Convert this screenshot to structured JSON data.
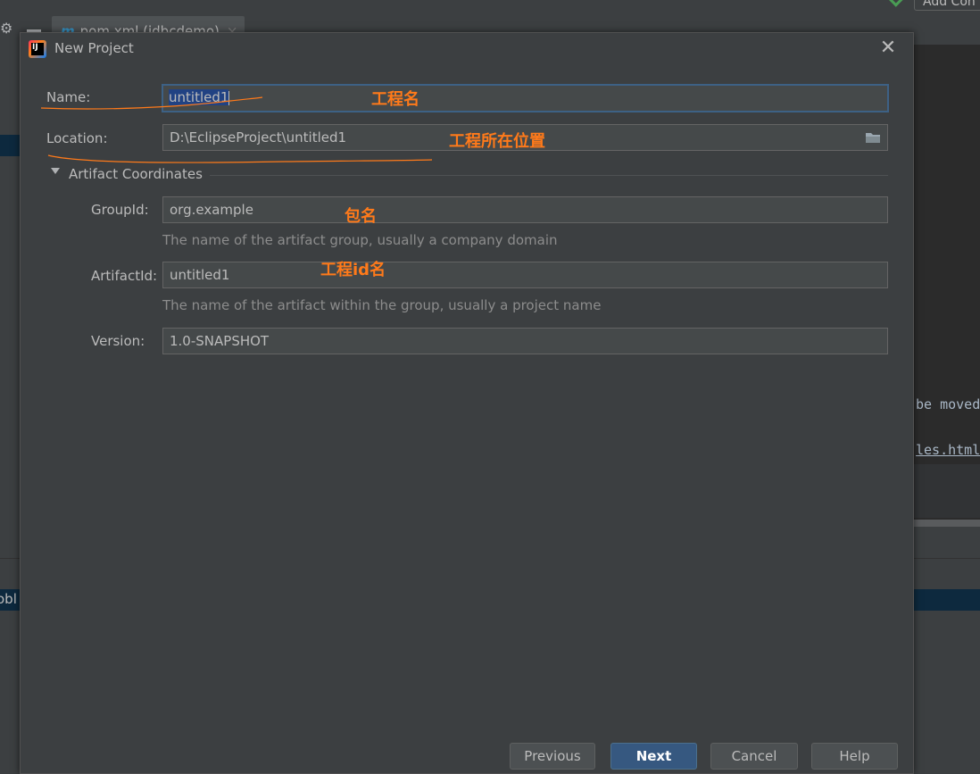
{
  "ide": {
    "tab_label": "pom.xml (jdbcdemo)",
    "tab_icon": "maven-m-icon",
    "add_config_label": "Add Con",
    "code_line_1": "be moved",
    "code_line_2": "les.html",
    "left_text": "obl"
  },
  "dialog": {
    "title": "New Project",
    "close_glyph": "✕",
    "app_icon": "intellij-logo-icon",
    "name": {
      "label": "Name:",
      "value": "untitled1"
    },
    "location": {
      "label": "Location:",
      "value": "D:\\EclipseProject\\untitled1",
      "button_icon": "folder-icon"
    },
    "artifact_section": {
      "title": "Artifact Coordinates",
      "expanded": true,
      "group_id": {
        "label": "GroupId:",
        "value": "org.example",
        "hint": "The name of the artifact group, usually a company domain"
      },
      "artifact_id": {
        "label": "ArtifactId:",
        "value": "untitled1",
        "hint": "The name of the artifact within the group, usually a project name"
      },
      "version": {
        "label": "Version:",
        "value": "1.0-SNAPSHOT"
      }
    },
    "buttons": {
      "previous": "Previous",
      "next": "Next",
      "cancel": "Cancel",
      "help": "Help"
    }
  },
  "annotations": {
    "color": "#ff7a1a",
    "name_note": "工程名",
    "location_note": "工程所在位置",
    "group_note": "包名",
    "artifact_note": "工程id名"
  }
}
